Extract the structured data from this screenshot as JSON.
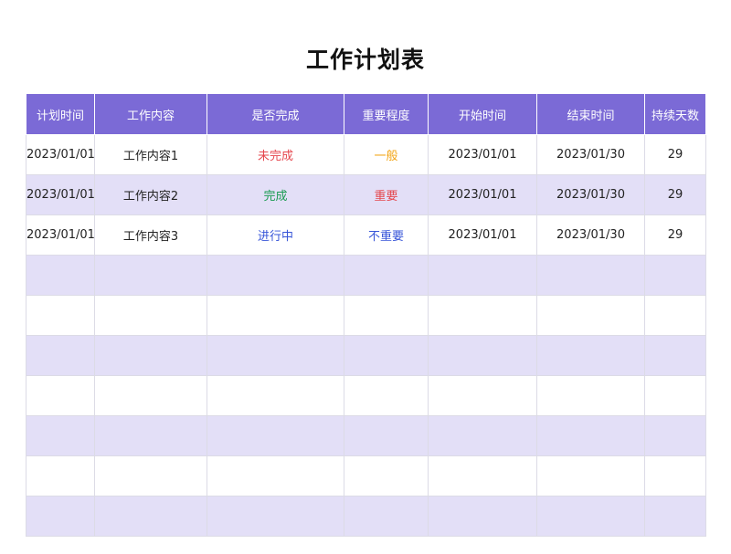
{
  "title": "工作计划表",
  "colors": {
    "header_bg": "#7b6ad6",
    "alt_row_bg": "#e3dff7",
    "red": "#e5474e",
    "green": "#1a9b52",
    "blue": "#3755d8",
    "orange": "#f2a516"
  },
  "table": {
    "headers": [
      "计划时间",
      "工作内容",
      "是否完成",
      "重要程度",
      "开始时间",
      "结束时间",
      "持续天数"
    ],
    "rows": [
      {
        "plan_date": "2023/01/01",
        "content": "工作内容1",
        "done": "未完成",
        "importance": "一般",
        "start": "2023/01/01",
        "end": "2023/01/30",
        "days": "29"
      },
      {
        "plan_date": "2023/01/01",
        "content": "工作内容2",
        "done": "完成",
        "importance": "重要",
        "start": "2023/01/01",
        "end": "2023/01/30",
        "days": "29"
      },
      {
        "plan_date": "2023/01/01",
        "content": "工作内容3",
        "done": "进行中",
        "importance": "不重要",
        "start": "2023/01/01",
        "end": "2023/01/30",
        "days": "29"
      }
    ]
  }
}
